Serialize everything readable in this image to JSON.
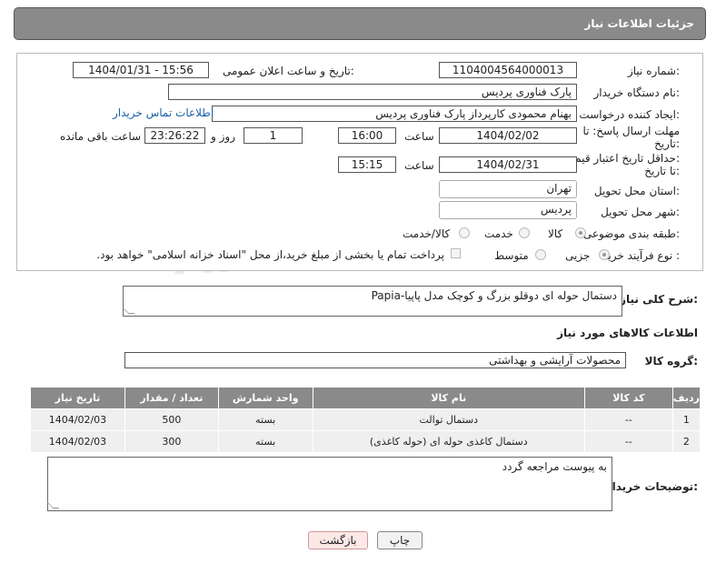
{
  "header": {
    "title": "جزئیات اطلاعات نیاز"
  },
  "form": {
    "need_number_label": "شماره نیاز:",
    "need_number": "1104004564000013",
    "announce_date_label": "تاریخ و ساعت اعلان عمومی:",
    "announce_date": "1404/01/31 - 15:56",
    "buyer_org_label": "نام دستگاه خریدار:",
    "buyer_org": "پارک فناوری پردیس",
    "requester_label": "ایجاد کننده درخواست:",
    "requester": "بهنام محمودی کارپرداز پارک فناوری پردیس",
    "buyer_contact_link": "اطلاعات تماس خریدار",
    "reply_deadline_label_1": "مهلت ارسال پاسخ: تا",
    "reply_deadline_label_2": "تاریخ:",
    "reply_date": "1404/02/02",
    "time_label": "ساعت",
    "reply_time": "16:00",
    "days_value": "1",
    "days_label": "روز و",
    "remaining_time": "23:26:22",
    "remaining_label": "ساعت باقی مانده",
    "price_deadline_label_1": "حداقل تاریخ اعتبار قیمت:",
    "price_deadline_label_2": "تا تاریخ:",
    "price_date": "1404/02/31",
    "price_time": "15:15",
    "province_label": "استان محل تحویل:",
    "province": "تهران",
    "city_label": "شهر محل تحویل:",
    "city": "پردیس",
    "category_label": "طبقه بندی موضوعی:",
    "category_options": [
      "کالا",
      "خدمت",
      "کالا/خدمت"
    ],
    "process_label": "نوع فرآیند خرید :",
    "process_options": [
      "جزیی",
      "متوسط"
    ],
    "payment_note": "پرداخت تمام یا بخشی از مبلغ خرید،از محل \"اسناد خزانه اسلامی\" خواهد بود."
  },
  "description": {
    "label": "شرح کلی نیاز:",
    "value": "دستمال حوله ای دوقلو بزرگ و کوچک مدل پاپیا-Papia"
  },
  "goods_section_title": "اطلاعات کالاهای مورد نیاز",
  "goods_group": {
    "label": "گروه کالا:",
    "value": "محصولات آرایشی و بهداشتی"
  },
  "table": {
    "headers": [
      "ردیف",
      "کد کالا",
      "نام کالا",
      "واحد شمارش",
      "تعداد / مقدار",
      "تاریخ نیاز"
    ],
    "rows": [
      [
        "1",
        "--",
        "دستمال توالت",
        "بسته",
        "500",
        "1404/02/03"
      ],
      [
        "2",
        "--",
        "دستمال کاغذی حوله ای (حوله کاغذی)",
        "بسته",
        "300",
        "1404/02/03"
      ]
    ]
  },
  "buyer_notes": {
    "label": "توضیحات خریدار:",
    "value": "به پیوست مراجعه گردد"
  },
  "buttons": {
    "print": "چاپ",
    "back": "بازگشت"
  },
  "watermark": "AriaTender.net"
}
